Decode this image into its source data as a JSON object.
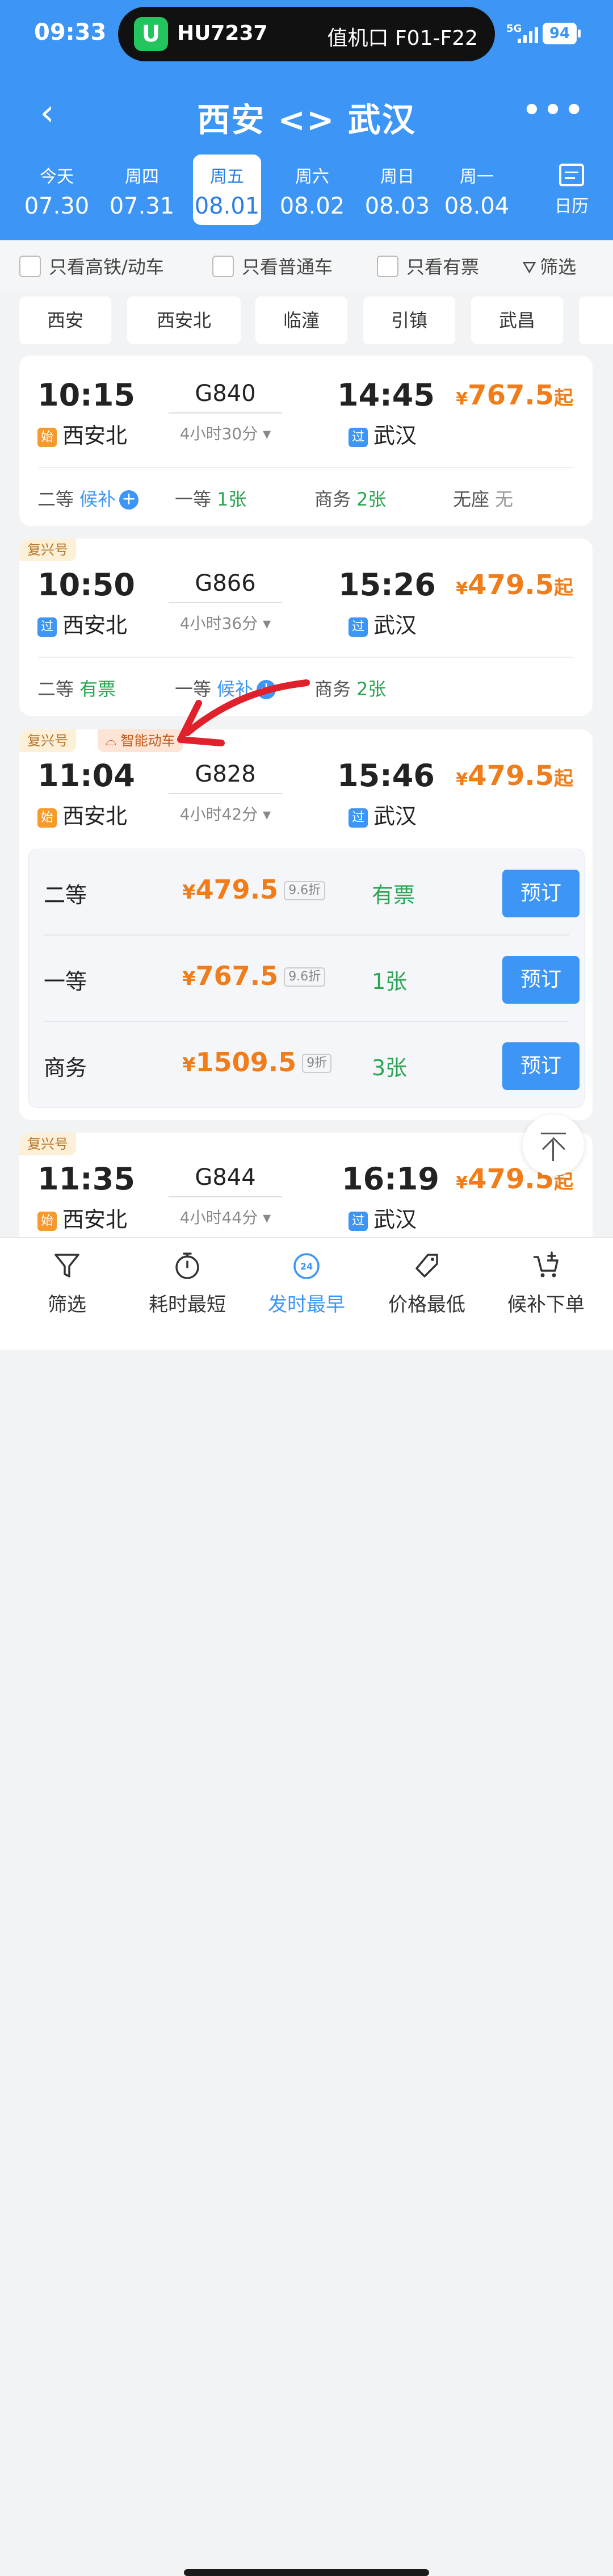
{
  "status_bar": {
    "time": "09:33",
    "flight_app_logo": "U",
    "flight_no": "HU7237",
    "gate_label": "值机口 F01-F22",
    "network": "5G",
    "battery": "94"
  },
  "nav": {
    "back": "‹",
    "route_title": "西安 <> 武汉",
    "more": "•••"
  },
  "dates": [
    {
      "dow": "今天",
      "date": "07.30"
    },
    {
      "dow": "周四",
      "date": "07.31"
    },
    {
      "dow": "周五",
      "date": "08.01"
    },
    {
      "dow": "周六",
      "date": "08.02"
    },
    {
      "dow": "周日",
      "date": "08.03"
    },
    {
      "dow": "周一",
      "date": "08.04"
    }
  ],
  "calendar_label": "日历",
  "filters": {
    "high_speed": "只看高铁/动车",
    "regular": "只看普通车",
    "available": "只看有票",
    "filter": "筛选"
  },
  "stations": [
    "西安",
    "西安北",
    "临潼",
    "引镇",
    "武昌"
  ],
  "trains": [
    {
      "tags": [],
      "dep_time": "10:15",
      "code": "G840",
      "arr_time": "14:45",
      "duration": "4小时30分",
      "dep_badge": "始",
      "dep_station": "西安北",
      "arr_badge": "过",
      "arr_station": "武汉",
      "price": "767.5",
      "price_suffix": "起",
      "currency": "¥",
      "seats": [
        {
          "name": "二等",
          "status": "候补"
        },
        {
          "name": "一等",
          "status": "1张"
        },
        {
          "name": "商务",
          "status": "2张"
        },
        {
          "name": "无座",
          "status": "无"
        }
      ]
    },
    {
      "tags": [
        "复兴号"
      ],
      "dep_time": "10:50",
      "code": "G866",
      "arr_time": "15:26",
      "duration": "4小时36分",
      "dep_badge": "过",
      "dep_station": "西安北",
      "arr_badge": "过",
      "arr_station": "武汉",
      "price": "479.5",
      "price_suffix": "起",
      "currency": "¥",
      "seats": [
        {
          "name": "二等",
          "status": "有票"
        },
        {
          "name": "一等",
          "status": "候补"
        },
        {
          "name": "商务",
          "status": "2张"
        }
      ]
    },
    {
      "tags": [
        "复兴号",
        "智能动车"
      ],
      "dep_time": "11:04",
      "code": "G828",
      "arr_time": "15:46",
      "duration": "4小时42分",
      "dep_badge": "始",
      "dep_station": "西安北",
      "arr_badge": "过",
      "arr_station": "武汉",
      "price": "479.5",
      "price_suffix": "起",
      "currency": "¥",
      "detail": [
        {
          "name": "二等",
          "price": "479.5",
          "discount": "9.6折",
          "avail": "有票",
          "action": "预订"
        },
        {
          "name": "一等",
          "price": "767.5",
          "discount": "9.6折",
          "avail": "1张",
          "action": "预订"
        },
        {
          "name": "商务",
          "price": "1509.5",
          "discount": "9折",
          "avail": "3张",
          "action": "预订"
        }
      ]
    },
    {
      "tags": [
        "复兴号"
      ],
      "dep_time": "11:35",
      "code": "G844",
      "arr_time": "16:19",
      "duration": "4小时44分",
      "dep_badge": "始",
      "dep_station": "西安北",
      "arr_badge": "过",
      "arr_station": "武汉",
      "price": "479.5",
      "price_suffix": "起",
      "currency": "¥"
    }
  ],
  "tabs": [
    {
      "label": "筛选",
      "icon": "filter-icon"
    },
    {
      "label": "耗时最短",
      "icon": "stopwatch-icon"
    },
    {
      "label": "发时最早",
      "icon": "clock-24-icon",
      "icon_text": "24",
      "active": true
    },
    {
      "label": "价格最低",
      "icon": "price-tag-icon"
    },
    {
      "label": "候补下单",
      "icon": "cart-plus-icon"
    }
  ],
  "colors": {
    "header_blue": "#3d96f5",
    "price_orange": "#f07d1a",
    "available_green": "#2aa552",
    "annotation_red": "#e0202a"
  }
}
